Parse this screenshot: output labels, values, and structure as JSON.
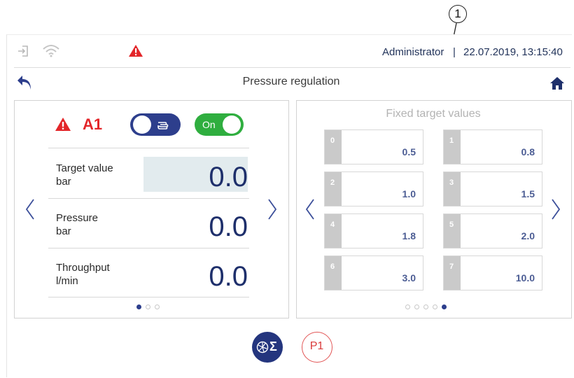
{
  "callout": {
    "number": "1"
  },
  "status_bar": {
    "login_icon": "login-icon",
    "wifi_icon": "wifi-icon",
    "alarm_icon": "warning-triangle-icon",
    "user": "Administrator",
    "separator": "|",
    "datetime": "22.07.2019, 13:15:40"
  },
  "header": {
    "back_icon": "back-arrow-icon",
    "title": "Pressure regulation",
    "home_icon": "home-icon"
  },
  "left_panel": {
    "alarm_icon": "warning-triangle-icon",
    "channel": "A1",
    "mode_toggle": {
      "icon": "manual-hand-icon",
      "state": "manual"
    },
    "power_toggle": {
      "label": "On",
      "state": "on"
    },
    "rows": [
      {
        "label_line1": "Target value",
        "label_line2": "bar",
        "value": "0.0"
      },
      {
        "label_line1": "Pressure",
        "label_line2": "bar",
        "value": "0.0"
      },
      {
        "label_line1": "Throughput",
        "label_line2": "l/min",
        "value": "0.0"
      }
    ],
    "pages": 3,
    "active_page": 0
  },
  "right_panel": {
    "title": "Fixed target values",
    "slots": [
      {
        "index": "0",
        "value": "0.5"
      },
      {
        "index": "1",
        "value": "0.8"
      },
      {
        "index": "2",
        "value": "1.0"
      },
      {
        "index": "3",
        "value": "1.5"
      },
      {
        "index": "4",
        "value": "1.8"
      },
      {
        "index": "5",
        "value": "2.0"
      },
      {
        "index": "6",
        "value": "3.0"
      },
      {
        "index": "7",
        "value": "10.0"
      }
    ],
    "pages": 5,
    "active_page": 4
  },
  "bottom_bar": {
    "sum_button_icon": "pump-sum-icon",
    "sum_symbol": "Σ",
    "preset_label": "P1"
  },
  "colors": {
    "accent": "#2d3e8c",
    "alarm": "#e3262a",
    "on_green": "#2fae3f",
    "value_text": "#1e2f6b"
  }
}
